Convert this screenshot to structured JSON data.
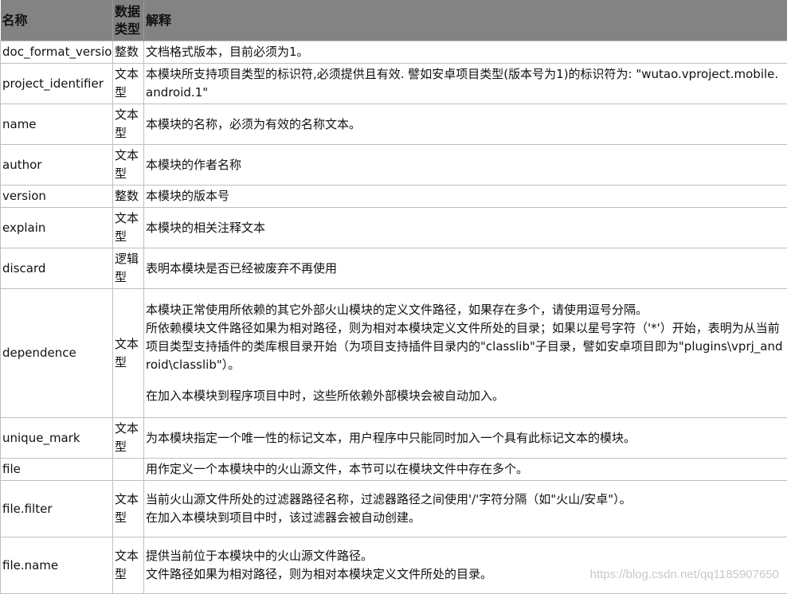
{
  "table": {
    "headers": [
      "名称",
      "数据类型",
      "解释"
    ],
    "rows": [
      {
        "name": "doc_format_version",
        "type": "整数",
        "desc": [
          "文档格式版本，目前必须为1。"
        ]
      },
      {
        "name": "project_identifier",
        "type": "文本型",
        "desc": [
          "本模块所支持项目类型的标识符,必须提供且有效. 譬如安卓项目类型(版本号为1)的标识符为: \"wutao.vproject.mobile.android.1\""
        ]
      },
      {
        "name": "name",
        "type": "文本型",
        "desc": [
          "本模块的名称，必须为有效的名称文本。"
        ]
      },
      {
        "name": "author",
        "type": "文本型",
        "desc": [
          "本模块的作者名称"
        ]
      },
      {
        "name": "version",
        "type": "整数",
        "desc": [
          "本模块的版本号"
        ]
      },
      {
        "name": "explain",
        "type": "文本型",
        "desc": [
          "本模块的相关注释文本"
        ]
      },
      {
        "name": "discard",
        "type": "逻辑型",
        "desc": [
          "表明本模块是否已经被废弃不再使用"
        ]
      },
      {
        "name": "dependence",
        "type": "文本型",
        "desc": [
          "本模块正常使用所依赖的其它外部火山模块的定义文件路径，如果存在多个，请使用逗号分隔。",
          "所依赖模块文件路径如果为相对路径，则为相对本模块定义文件所处的目录；如果以星号字符（'*'）开始，表明为从当前项目类型支持插件的类库根目录开始（为项目支持插件目录内的\"classlib\"子目录，譬如安卓项目即为\"plugins\\vprj_android\\classlib\"）。",
          "在加入本模块到程序项目中时，这些所依赖外部模块会被自动加入。"
        ]
      },
      {
        "name": "unique_mark",
        "type": "文本型",
        "desc": [
          "为本模块指定一个唯一性的标记文本，用户程序中只能同时加入一个具有此标记文本的模块。"
        ]
      },
      {
        "name": "file",
        "type": "",
        "desc": [
          "用作定义一个本模块中的火山源文件，本节可以在模块文件中存在多个。"
        ]
      },
      {
        "name": "file.filter",
        "type": "文本型",
        "desc": [
          "当前火山源文件所处的过滤器路径名称，过滤器路径之间使用'/'字符分隔（如\"火山/安卓\"）。",
          "在加入本模块到项目中时，该过滤器会被自动创建。"
        ]
      },
      {
        "name": "file.name",
        "type": "文本型",
        "desc": [
          "提供当前位于本模块中的火山源文件路径。",
          "文件路径如果为相对路径，则为相对本模块定义文件所处的目录。"
        ]
      }
    ]
  },
  "watermark": "https://blog.csdn.net/qq1185907650"
}
